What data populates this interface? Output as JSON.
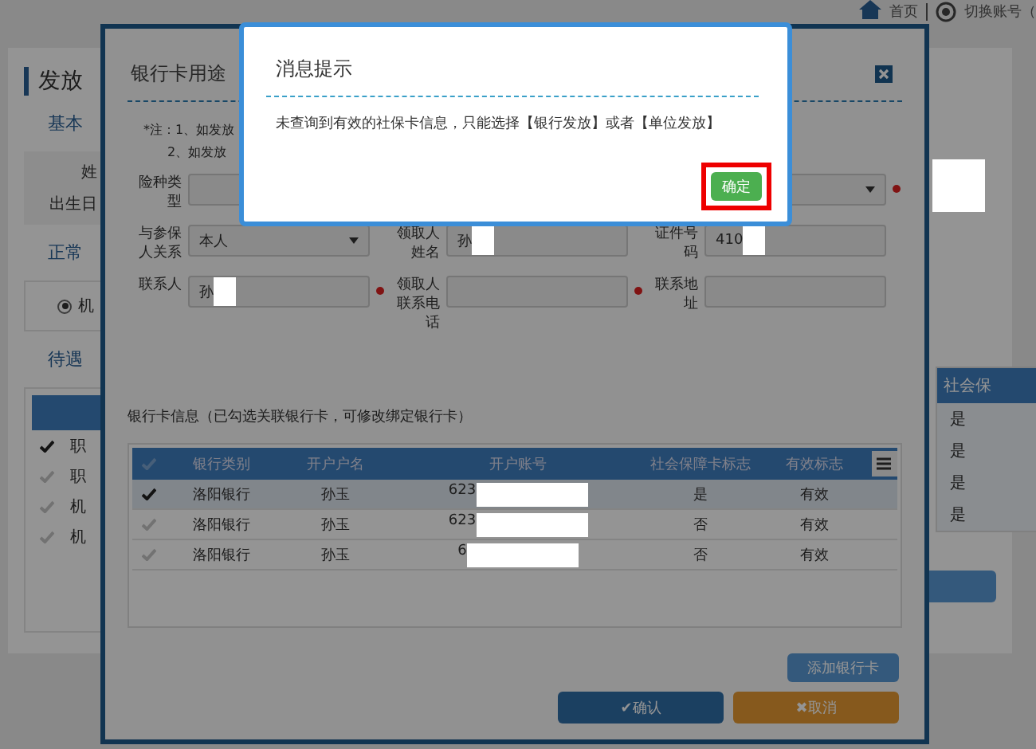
{
  "top_bar": {
    "home_label": "首页",
    "switch_account": "切换账号（"
  },
  "background_page": {
    "title": "发放",
    "basic_heading": "基本",
    "field_labels": [
      "姓",
      "出生日"
    ],
    "normal_heading": "正常",
    "radio": {
      "label": "机",
      "selected": true
    },
    "pending_heading": "待遇",
    "rows": [
      {
        "label": "职",
        "checked": true
      },
      {
        "label": "职",
        "checked": false
      },
      {
        "label": "机",
        "checked": false
      },
      {
        "label": "机",
        "checked": false
      }
    ],
    "right_header": "社会保",
    "right_cells": [
      "是",
      "是",
      "是",
      "是"
    ]
  },
  "dialog": {
    "title": "银行卡用途",
    "notes": [
      "*注：1、如发放",
      "2、如发放"
    ],
    "fields": [
      {
        "label": "险种类型",
        "kind": "select",
        "required": true,
        "redacted": false,
        "wide": true
      },
      {
        "label": "与参保人关系",
        "kind": "select",
        "value": "本人",
        "required": false,
        "redacted": false,
        "wide": false
      },
      {
        "label": "领取人姓名",
        "kind": "text",
        "value": "孙",
        "required": false,
        "redacted": true,
        "wide": false
      },
      {
        "label": "证件号码",
        "kind": "text",
        "value": "410",
        "required": false,
        "redacted": true,
        "wide": false
      },
      {
        "label": "联系人",
        "kind": "text",
        "value": "孙",
        "required": true,
        "redacted": true,
        "wide": false
      },
      {
        "label": "领取人联系电话",
        "kind": "text",
        "required": true,
        "redacted": false,
        "wide": false
      },
      {
        "label": "联系地址",
        "kind": "text",
        "required": false,
        "redacted": false,
        "wide": false
      }
    ],
    "bank_heading": "银行卡信息（已勾选关联银行卡，可修改绑定银行卡）",
    "select_all": false,
    "columns": [
      "银行类别",
      "开户户名",
      "开户账号",
      "社会保障卡标志",
      "有效标志"
    ],
    "rows": [
      {
        "bank": "洛阳银行",
        "name": "孙玉",
        "account": "623",
        "ssc": "是",
        "valid": "有效",
        "selected": true
      },
      {
        "bank": "洛阳银行",
        "name": "孙玉",
        "account": "623",
        "ssc": "否",
        "valid": "有效",
        "selected": false
      },
      {
        "bank": "洛阳银行",
        "name": "孙玉",
        "account": "6",
        "ssc": "否",
        "valid": "有效",
        "selected": false
      }
    ],
    "add_button": "添加银行卡",
    "confirm_button": "✔确认",
    "cancel_button": "✖取消"
  },
  "message_box": {
    "title": "消息提示",
    "text": "未查询到有效的社保卡信息，只能选择【银行发放】或者【单位发放】",
    "ok_button": "确定",
    "highlighted": true
  }
}
